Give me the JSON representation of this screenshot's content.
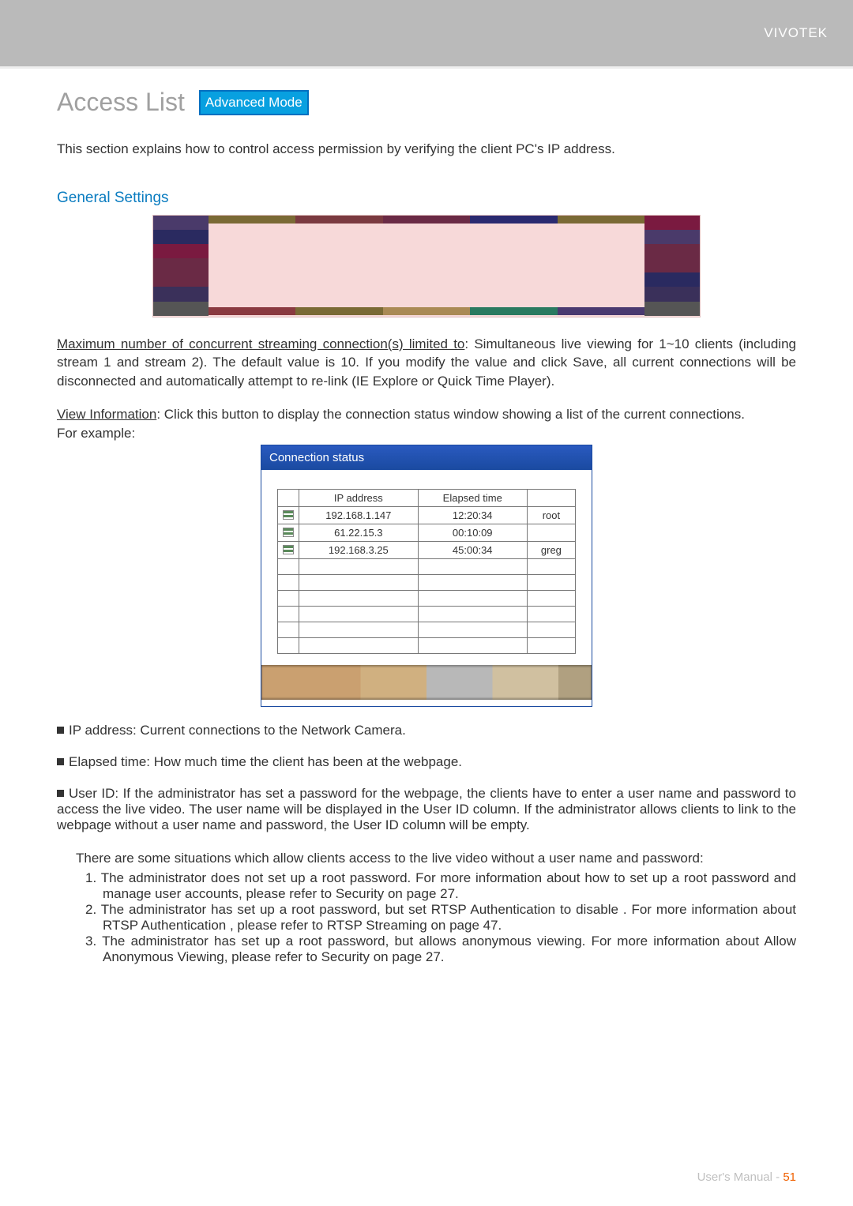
{
  "brand": "VIVOTEK",
  "title": "Access List",
  "badge": "Advanced Mode",
  "intro": "This section explains how to control access permission by verifying the client PC's IP address.",
  "general_heading": "General Settings",
  "p_maxconn_label": "Maximum number of concurrent streaming connection(s) limited to",
  "p_maxconn_body": ": Simultaneous live viewing for 1~10 clients (including stream 1 and stream 2). The default value is 10. If you modify the value and click Save, all current connections will be disconnected and automatically attempt to re-link (IE Explore or Quick Time Player).",
  "p_viewinfo_label": "View Information",
  "p_viewinfo_body": ": Click this button to display the connection status window showing a list of the current connections.",
  "for_example": "For example:",
  "conn": {
    "title": "Connection status",
    "headers": {
      "ip": "IP address",
      "elapsed": "Elapsed time",
      "user": ""
    },
    "rows": [
      {
        "ip": "192.168.1.147",
        "elapsed": "12:20:34",
        "user": "root"
      },
      {
        "ip": "61.22.15.3",
        "elapsed": "00:10:09",
        "user": ""
      },
      {
        "ip": "192.168.3.25",
        "elapsed": "45:00:34",
        "user": "greg"
      }
    ]
  },
  "bullets": {
    "ip_label": "IP address",
    "ip_body": ": Current connections to the Network Camera.",
    "et_label": "Elapsed time",
    "et_body": ": How much time the client has been at the webpage.",
    "uid_label": "User ID",
    "uid_body": ": If the administrator has set a password for the webpage, the clients have to enter a user name and password to access the live video. The user name will be displayed in the User ID column. If  the administrator allows clients to link to the webpage without a user name and password, the User ID column will be empty."
  },
  "situations_intro": "There are some situations which allow clients access to the live video without a user name and password:",
  "situations": [
    "1. The administrator does not set up a root password. For more information about how to set up a root password and manage user accounts, please refer to Security on page 27.",
    "2. The administrator has set up a root password, but set RTSP Authentication to  disable . For more information about RTSP Authentication   , please refer to RTSP Streaming on page 47.",
    "3. The administrator has set up a root password, but allows anonymous viewing. For more information about Allow Anonymous Viewing,     please refer to Security on page 27."
  ],
  "footer": {
    "label": "User's Manual - ",
    "page": "51"
  }
}
